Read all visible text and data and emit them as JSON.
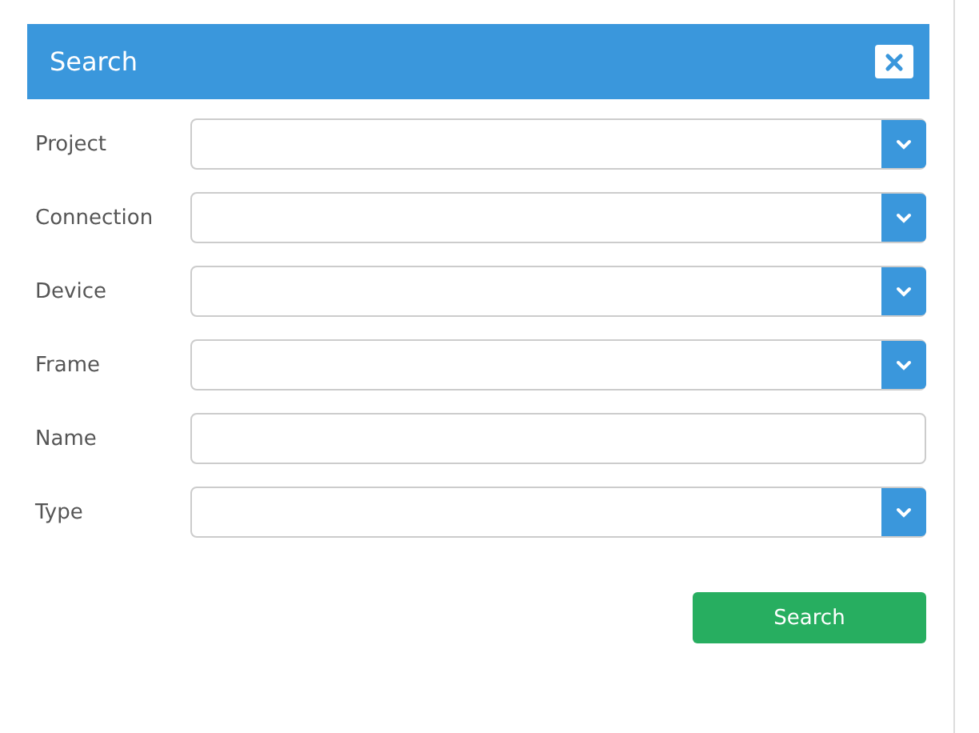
{
  "dialog": {
    "title": "Search"
  },
  "fields": [
    {
      "label": "Project",
      "kind": "select"
    },
    {
      "label": "Connection",
      "kind": "select"
    },
    {
      "label": "Device",
      "kind": "select"
    },
    {
      "label": "Frame",
      "kind": "select"
    },
    {
      "label": "Name",
      "kind": "text"
    },
    {
      "label": "Type",
      "kind": "select"
    }
  ],
  "submit": {
    "label": "Search"
  }
}
